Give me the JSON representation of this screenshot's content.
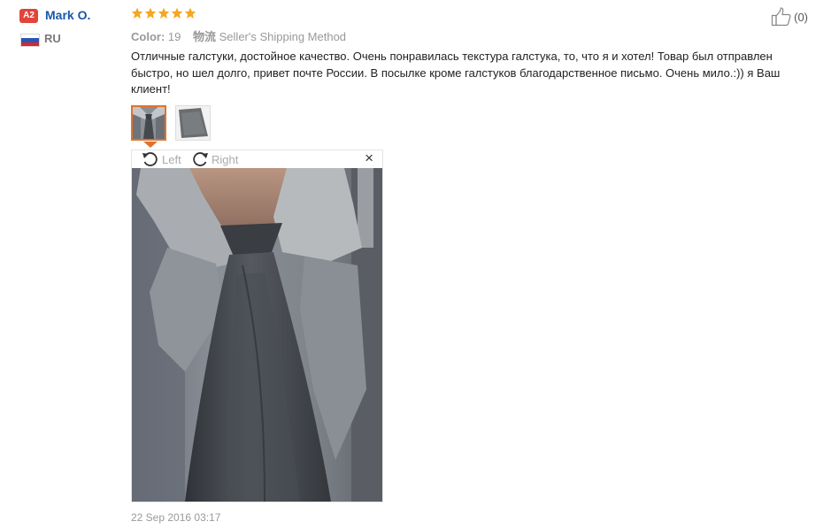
{
  "reviewer": {
    "badge": "A2",
    "name": "Mark O.",
    "country": "RU"
  },
  "rating": {
    "stars": 5,
    "max": 5
  },
  "meta": {
    "color_label": "Color:",
    "color_value": "19",
    "shipping_label": "物流",
    "shipping_value": "Seller's Shipping Method"
  },
  "helpful": {
    "count": "(0)",
    "icon": "thumbs-up-icon"
  },
  "review_text": "Отличные галстуки, достойное качество. Очень понравилась текстура галстука, то, что я и хотел! Товар был отправлен быстро, но шел долго, привет почте России. В посылке кроме галстуков благодарственное письмо. Очень мило.:)) я Ваш клиент!",
  "viewer": {
    "rotate_left": "Left",
    "rotate_right": "Right",
    "close": "×"
  },
  "date": "22 Sep 2016 03:17",
  "colors": {
    "accent": "#e0732a",
    "star": "#f5a623",
    "name": "#1a55a8",
    "badge": "#e0443a"
  }
}
